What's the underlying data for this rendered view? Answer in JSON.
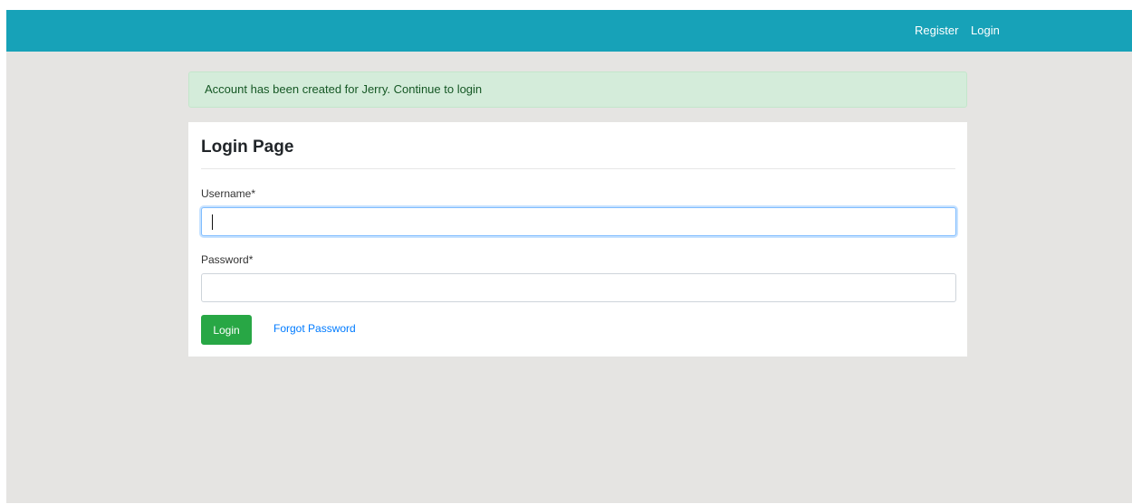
{
  "navbar": {
    "register_label": "Register",
    "login_label": "Login",
    "background_color": "#17a2b8"
  },
  "alert": {
    "message": "Account has been created for Jerry. Continue to login",
    "background_color": "#d4ecda"
  },
  "login_form": {
    "title": "Login Page",
    "username_label": "Username*",
    "username_value": "",
    "password_label": "Password*",
    "password_value": "",
    "submit_label": "Login",
    "forgot_password_label": "Forgot Password",
    "submit_color": "#28a745",
    "link_color": "#007bff"
  }
}
